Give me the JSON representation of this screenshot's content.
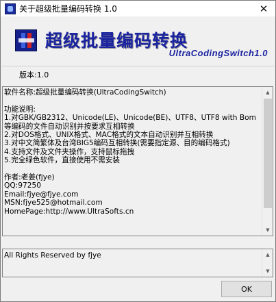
{
  "window": {
    "title": "关于超级批量编码转换 1.0",
    "close_symbol": "✕"
  },
  "banner": {
    "title": "超级批量编码转换",
    "subtitle": "UltraCodingSwitch1.0"
  },
  "version_label": "版本:1.0",
  "info_text": "软件名称:超级批量编码转换(UltraCodingSwitch)\n\n功能说明:\n1.对GBK/GB2312、Unicode(LE)、Unicode(BE)、UTF8、UTF8 with Bom等编码的文件自动识别并按要求互相转换\n2.对DOS格式、UNIX格式、MAC格式的文本自动识别并互相转换\n3.对中文简繁体及台湾BIG5编码互相转换(需要指定源、目的编码格式)\n4.支持文件及文件夹操作，支持鼠标拖拽\n5.完全绿色软件，直接使用不需安装\n\n作者:老姜(fjye)\nQQ:97250\nEmail:fjye@fjye.com\nMSN:fjye525@hotmail.com\nHomePage:http://www.UltraSofts.cn",
  "copyright_text": "All Rights Reserved by fjye",
  "ok_label": "OK",
  "icons": {
    "up_arrow": "▲",
    "down_arrow": "▼"
  }
}
